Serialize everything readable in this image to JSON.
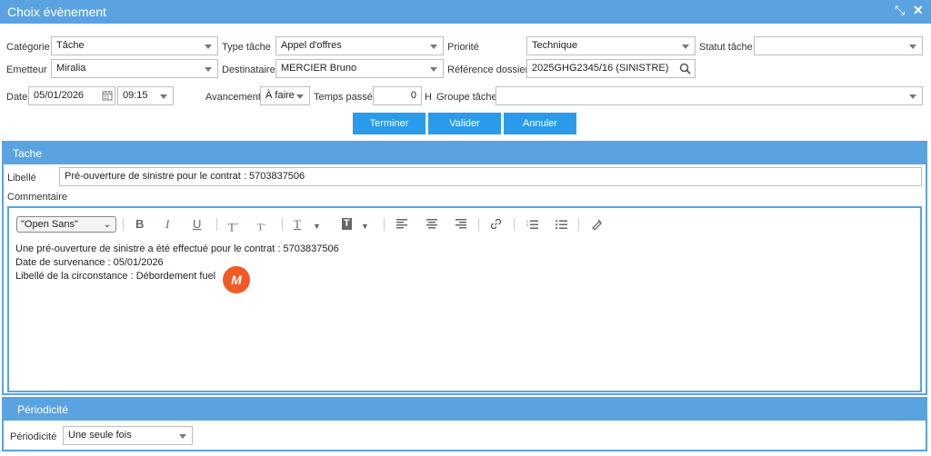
{
  "window": {
    "title": "Choix évènement"
  },
  "form": {
    "categorie_label": "Catégorie",
    "categorie_value": "Tâche",
    "type_tache_label": "Type tâche",
    "type_tache_value": "Appel d'offres",
    "priorite_label": "Priorité",
    "priorite_value": "Technique",
    "statut_label": "Statut tâche",
    "statut_value": "",
    "emetteur_label": "Emetteur",
    "emetteur_value": "Miralia",
    "destinataire_label": "Destinataire",
    "destinataire_value": "MERCIER Bruno",
    "reference_label": "Référence dossier",
    "reference_value": "2025GHG2345/16 (SINISTRE)",
    "date_label": "Date",
    "date_value": "05/01/2026",
    "time_value": "09:15",
    "avancement_label": "Avancement",
    "avancement_value": "À faire",
    "temps_label": "Temps passé",
    "temps_value": "0",
    "temps_unit": "H",
    "groupe_label": "Groupe tâche",
    "groupe_value": ""
  },
  "buttons": {
    "terminer": "Terminer",
    "valider": "Valider",
    "annuler": "Annuler"
  },
  "tache": {
    "header": "Tache",
    "libelle_label": "Libellé",
    "libelle_value": "Pré-ouverture de sinistre pour le contrat : 5703837506",
    "commentaire_label": "Commentaire"
  },
  "editor": {
    "font_select": "\"Open Sans\"",
    "lines": [
      "Une pré-ouverture de sinistre a été effectué pour le contrat : 5703837506",
      "Date de survenance : 05/01/2026",
      "Libellé de la circonstance : Débordement fuel"
    ],
    "logo_text": "M",
    "logo_color": "#f15a24"
  },
  "periodicite": {
    "header": "Périodicité",
    "label": "Périodicité",
    "value": "Une seule fois"
  },
  "colors": {
    "primary": "#5ba3e0",
    "button": "#2a9bea"
  }
}
